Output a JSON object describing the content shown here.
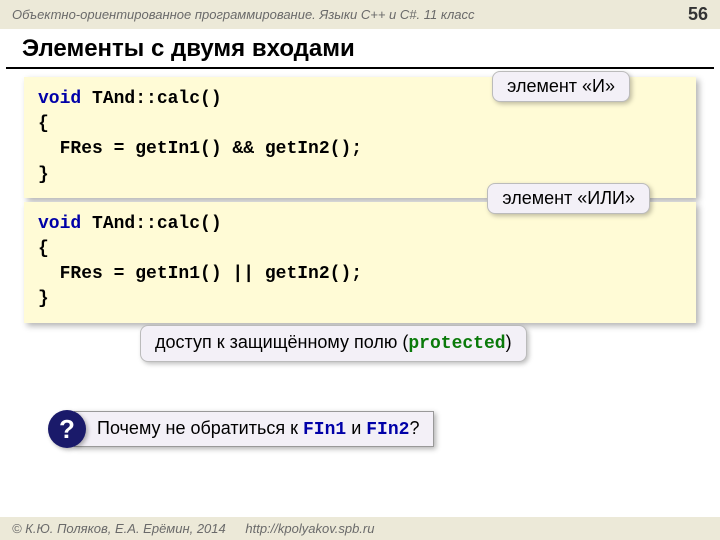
{
  "header": {
    "course": "Объектно-ориентированное программирование. Языки C++ и C#. 11 класс",
    "page": "56"
  },
  "title": "Элементы с двумя входами",
  "code1": {
    "l1a": "void",
    "l1b": " TAnd::calc()",
    "l2": "{",
    "l3": "  FRes = getIn1() && getIn2();",
    "l4": "}"
  },
  "code2": {
    "l1a": "void",
    "l1b": " TAnd::calc()",
    "l2": "{",
    "l3": "  FRes = getIn1() || getIn2();",
    "l4": "}"
  },
  "callouts": {
    "and": "элемент «И»",
    "or": "элемент «ИЛИ»",
    "protected_pre": "доступ к защищённому полю (",
    "protected_kw": "protected",
    "protected_post": ")"
  },
  "question": {
    "mark": "?",
    "pre": "Почему не обратиться к ",
    "f1": "FIn1",
    "mid": " и ",
    "f2": "FIn2",
    "post": "?"
  },
  "footer": {
    "copyright": "© К.Ю. Поляков, Е.А. Ерёмин, 2014",
    "url": "http://kpolyakov.spb.ru"
  }
}
